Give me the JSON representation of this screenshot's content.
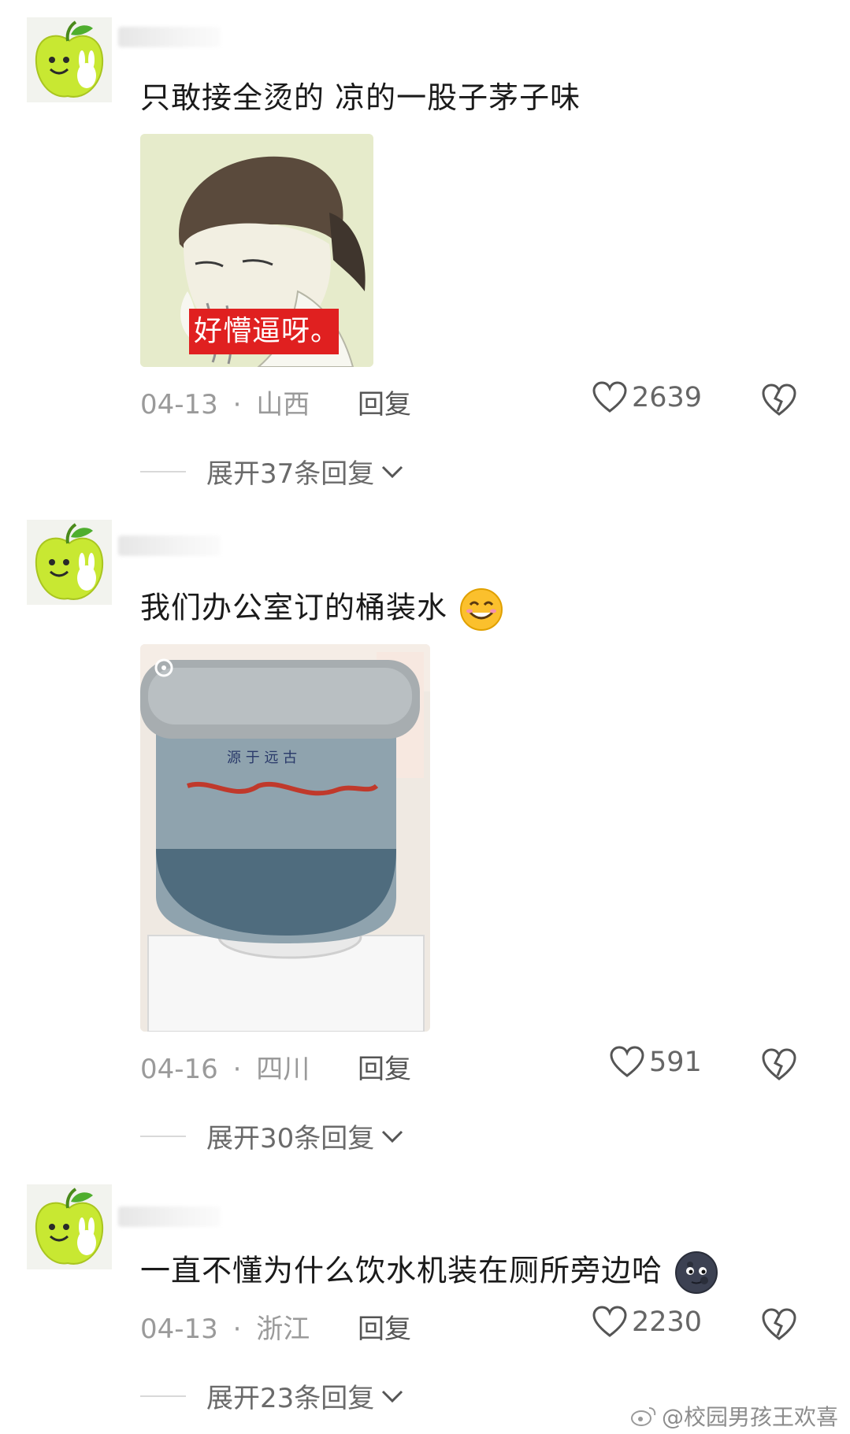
{
  "comments": [
    {
      "text": "只敢接全烫的 凉的一股子茅子味",
      "image_caption": "好懵逼呀。",
      "date": "04-13",
      "region": "山西",
      "reply_label": "回复",
      "likes": "2639",
      "expand_label": "展开37条回复"
    },
    {
      "text": "我们办公室订的桶装水",
      "emoji": "smiling-face-emoji",
      "date": "04-16",
      "region": "四川",
      "reply_label": "回复",
      "likes": "591",
      "expand_label": "展开30条回复"
    },
    {
      "text": "一直不懂为什么饮水机装在厕所旁边哈",
      "emoji": "new-moon-face-emoji",
      "date": "04-13",
      "region": "浙江",
      "reply_label": "回复",
      "likes": "2230",
      "expand_label": "展开23条回复"
    }
  ],
  "separator": "·",
  "watermark": "@校园男孩王欢喜",
  "colors": {
    "avatar_green": "#c8e832",
    "caption_red": "#e02020",
    "meta_gray": "#9a9a9a"
  }
}
